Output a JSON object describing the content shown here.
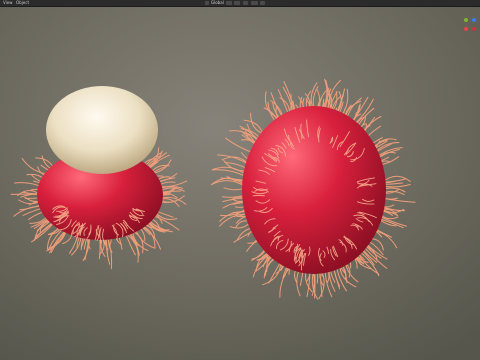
{
  "header": {
    "menu_view": "View",
    "menu_object": "Object",
    "mode_label": "Global"
  },
  "viewport": {
    "subject": "rambutan-3d-render"
  },
  "colors": {
    "background": "#6e6b5c",
    "fruit_flesh": "#d61f3c",
    "hair": "#f6a17e",
    "aril": "#f1e6c9",
    "gizmo_x": "#e0474c",
    "gizmo_y": "#7fb335",
    "gizmo_z": "#3a7ee6"
  }
}
